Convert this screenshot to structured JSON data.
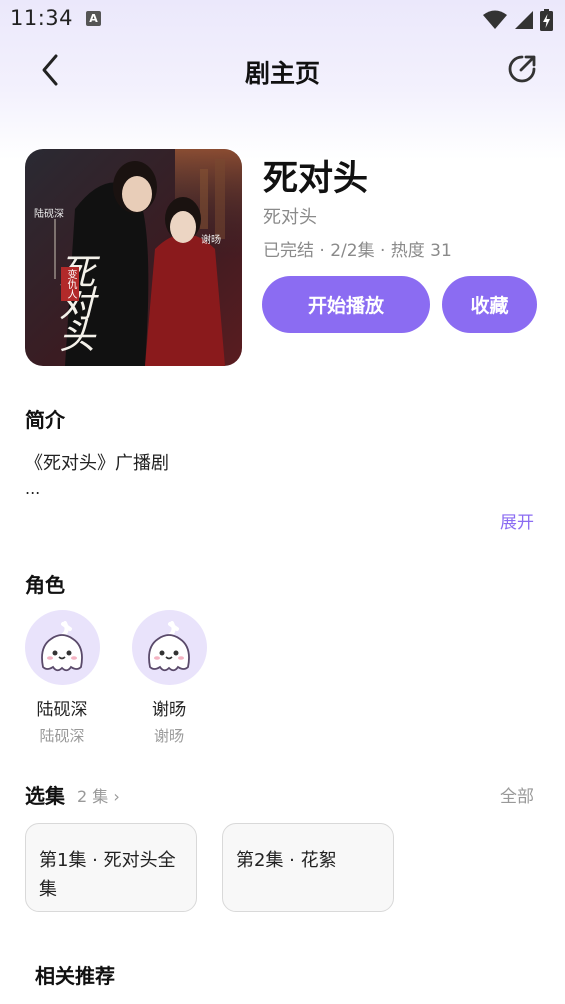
{
  "status_bar": {
    "time": "11:34",
    "notification_badge": "A",
    "icons": [
      "wifi-icon",
      "signal-icon",
      "battery-charging-icon"
    ]
  },
  "nav": {
    "title": "剧主页",
    "back_icon": "chevron-left-icon",
    "share_icon": "share-icon"
  },
  "drama": {
    "title": "死对头",
    "subtitle": "死对头",
    "meta": "已完结 · 2/2集 · 热度 31",
    "play_label": "开始播放",
    "favorite_label": "收藏",
    "cover_texts": {
      "name_left": "陆砚深",
      "name_right": "谢旸",
      "big_title": "死对头",
      "tag": "变仇人"
    }
  },
  "intro": {
    "heading": "简介",
    "line1": "《死对头》广播剧",
    "line2": "...",
    "expand_label": "展开"
  },
  "roles": {
    "heading": "角色",
    "items": [
      {
        "name": "陆砚深",
        "cv": "陆砚深"
      },
      {
        "name": "谢旸",
        "cv": "谢旸"
      }
    ]
  },
  "episodes": {
    "heading": "选集",
    "count": "2 集 ›",
    "all_label": "全部",
    "items": [
      {
        "line1": "第1集 · 死对头全",
        "line2": "集"
      },
      {
        "line1": "第2集 · 花絮",
        "line2": ""
      }
    ]
  },
  "recommend": {
    "heading": "相关推荐"
  },
  "colors": {
    "accent": "#8b6cf2",
    "header_tint": "#ebe8fb",
    "avatar_bg": "#e9e3fb"
  }
}
